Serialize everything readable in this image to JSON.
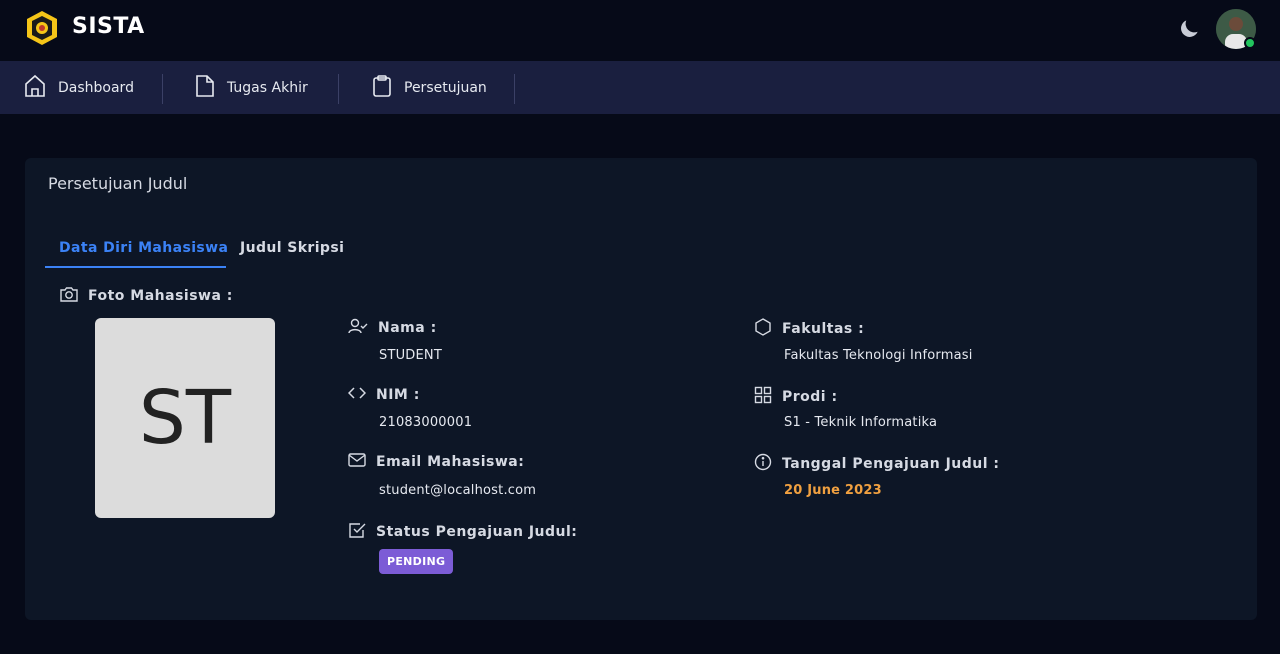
{
  "app": {
    "brand": "SISTA"
  },
  "topbar": {
    "theme_toggle_icon": "moon-icon",
    "avatar_status_color": "#22c55e"
  },
  "nav": {
    "items": [
      {
        "label": "Dashboard",
        "icon": "home-icon"
      },
      {
        "label": "Tugas Akhir",
        "icon": "file-icon"
      },
      {
        "label": "Persetujuan",
        "icon": "clipboard-icon"
      }
    ]
  },
  "card": {
    "title": "Persetujuan Judul",
    "tabs": [
      {
        "label": "Data Diri Mahasiswa",
        "active": true
      },
      {
        "label": "Judul Skripsi",
        "active": false
      }
    ],
    "photo": {
      "label": "Foto Mahasiswa :",
      "initials": "ST"
    },
    "fields": {
      "nama": {
        "label": "Nama :",
        "value": "STUDENT"
      },
      "nim": {
        "label": "NIM :",
        "value": "21083000001"
      },
      "email": {
        "label": "Email Mahasiswa:",
        "value": "student@localhost.com"
      },
      "status": {
        "label": "Status Pengajuan Judul:",
        "value": "PENDING"
      },
      "fakultas": {
        "label": "Fakultas :",
        "value": "Fakultas Teknologi Informasi"
      },
      "prodi": {
        "label": "Prodi :",
        "value": "S1 - Teknik Informatika"
      },
      "tanggal": {
        "label": "Tanggal Pengajuan Judul :",
        "value": "20 June 2023"
      }
    }
  },
  "colors": {
    "accent": "#3b82f6",
    "date": "#f0a040",
    "status_badge": "#7c5cd6",
    "navbar": "#1a1f3f",
    "card": "#0d1626"
  }
}
